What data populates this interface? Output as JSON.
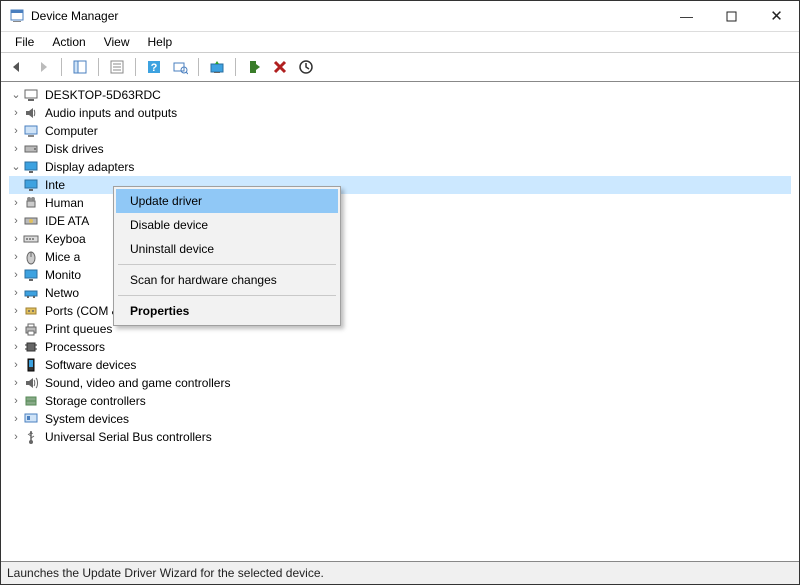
{
  "window": {
    "title": "Device Manager"
  },
  "menu": {
    "file": "File",
    "action": "Action",
    "view": "View",
    "help": "Help"
  },
  "tree": {
    "root": "DESKTOP-5D63RDC",
    "items": [
      {
        "label": "Audio inputs and outputs"
      },
      {
        "label": "Computer"
      },
      {
        "label": "Disk drives"
      },
      {
        "label": "Display adapters",
        "expanded": true,
        "child": "Inte"
      },
      {
        "label": "Human"
      },
      {
        "label": "IDE ATA"
      },
      {
        "label": "Keyboa"
      },
      {
        "label": "Mice a"
      },
      {
        "label": "Monito"
      },
      {
        "label": "Netwo"
      },
      {
        "label": "Ports (COM & LPT)"
      },
      {
        "label": "Print queues"
      },
      {
        "label": "Processors"
      },
      {
        "label": "Software devices"
      },
      {
        "label": "Sound, video and game controllers"
      },
      {
        "label": "Storage controllers"
      },
      {
        "label": "System devices"
      },
      {
        "label": "Universal Serial Bus controllers"
      }
    ]
  },
  "context_menu": {
    "update": "Update driver",
    "disable": "Disable device",
    "uninstall": "Uninstall device",
    "scan": "Scan for hardware changes",
    "properties": "Properties"
  },
  "status": "Launches the Update Driver Wizard for the selected device."
}
